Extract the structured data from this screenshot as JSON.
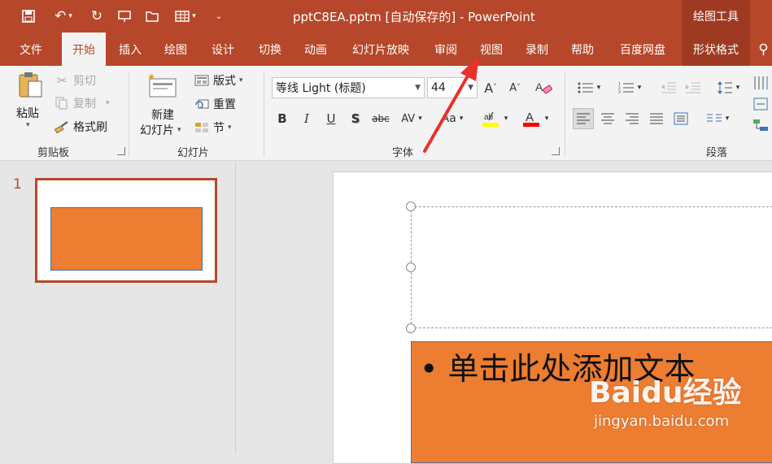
{
  "window": {
    "title": "pptC8EA.pptm [自动保存的]  -  PowerPoint",
    "context_label": "绘图工具",
    "quick_access": [
      "save-icon",
      "undo-icon",
      "redo-icon",
      "present-icon",
      "open-icon",
      "table-icon",
      "customize-icon"
    ]
  },
  "tabs": [
    "文件",
    "开始",
    "插入",
    "绘图",
    "设计",
    "切换",
    "动画",
    "幻灯片放映",
    "审阅",
    "视图",
    "录制",
    "帮助",
    "百度网盘",
    "形状格式"
  ],
  "active_tab": "开始",
  "clipboard": {
    "paste_label": "粘贴",
    "cut_label": "剪切",
    "copy_label": "复制",
    "format_painter_label": "格式刷",
    "group_label": "剪贴板"
  },
  "slides_group": {
    "new_slide_line1": "新建",
    "new_slide_line2": "幻灯片",
    "layout_label": "版式",
    "reset_label": "重置",
    "section_label": "节",
    "group_label": "幻灯片"
  },
  "font_group": {
    "font_name": "等线 Light (标题)",
    "font_size": "44",
    "group_label": "字体",
    "bold": "B",
    "italic": "I",
    "underline": "U",
    "shadow": "S",
    "strike": "abc",
    "spacing": "AV",
    "case": "Aa",
    "grow": "A",
    "shrink": "A",
    "highlight_color": "#ffff00",
    "font_color": "#ff0000"
  },
  "paragraph_group": {
    "group_label": "段落"
  },
  "slide_panel": {
    "slide_number": "1"
  },
  "slide": {
    "body_text": "• 单击此处添加文本"
  },
  "watermark": {
    "brand": "Baidu经验",
    "url": "jingyan.baidu.com"
  },
  "colors": {
    "accent": "#b7472a",
    "shape_fill": "#ed7d31",
    "annotation_arrow": "#e8322b"
  }
}
